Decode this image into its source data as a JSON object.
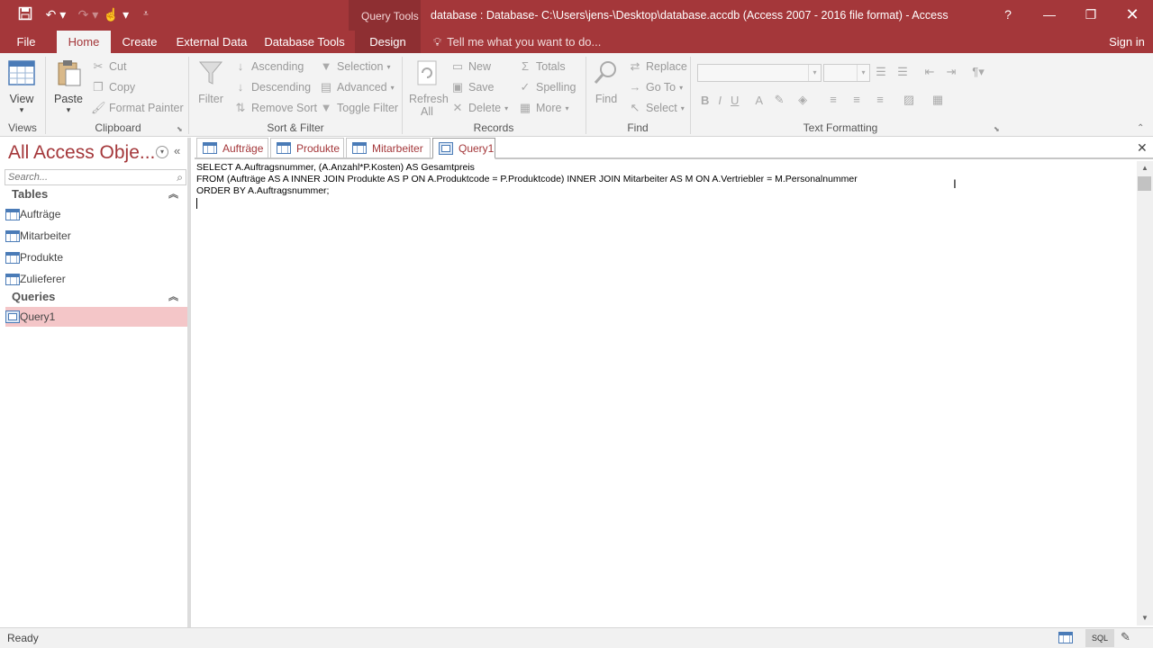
{
  "window": {
    "title": "database : Database- C:\\Users\\jens-\\Desktop\\database.accdb (Access 2007 - 2016 file format) - Access",
    "context_tab_group": "Query Tools",
    "help": "?",
    "sign_in": "Sign in"
  },
  "ribbon_tabs": [
    "File",
    "Home",
    "Create",
    "External Data",
    "Database Tools",
    "Design"
  ],
  "tell_me": "Tell me what you want to do...",
  "ribbon": {
    "views": {
      "view": "View",
      "label": "Views"
    },
    "clipboard": {
      "paste": "Paste",
      "cut": "Cut",
      "copy": "Copy",
      "format_painter": "Format Painter",
      "label": "Clipboard"
    },
    "sort_filter": {
      "filter": "Filter",
      "ascending": "Ascending",
      "descending": "Descending",
      "remove_sort": "Remove Sort",
      "selection": "Selection",
      "advanced": "Advanced",
      "toggle_filter": "Toggle Filter",
      "label": "Sort & Filter"
    },
    "records": {
      "refresh_all": "Refresh",
      "refresh_all_2": "All",
      "new": "New",
      "save": "Save",
      "delete": "Delete",
      "totals": "Totals",
      "spelling": "Spelling",
      "more": "More",
      "label": "Records"
    },
    "find": {
      "find": "Find",
      "replace": "Replace",
      "goto": "Go To",
      "select": "Select",
      "label": "Find"
    },
    "text_formatting": {
      "bold": "B",
      "italic": "I",
      "underline": "U",
      "font_color": "A",
      "label": "Text Formatting"
    }
  },
  "nav": {
    "title": "All Access Obje...",
    "search_placeholder": "Search...",
    "sections": [
      {
        "label": "Tables",
        "items": [
          "Aufträge",
          "Mitarbeiter",
          "Produkte",
          "Zulieferer"
        ]
      },
      {
        "label": "Queries",
        "items": [
          "Query1"
        ]
      }
    ]
  },
  "doc_tabs": [
    "Aufträge",
    "Produkte",
    "Mitarbeiter",
    "Query1"
  ],
  "sql": [
    "SELECT A.Auftragsnummer, (A.Anzahl*P.Kosten) AS Gesamtpreis",
    "FROM (Aufträge AS A INNER JOIN Produkte AS P ON A.Produktcode = P.Produktcode) INNER JOIN Mitarbeiter AS M ON A.Vertriebler = M.Personalnummer",
    "ORDER BY A.Auftragsnummer;"
  ],
  "status": {
    "text": "Ready",
    "sql_view": "SQL"
  },
  "colors": {
    "accent": "#a4373a",
    "selected_nav": "#f4c6c8"
  }
}
